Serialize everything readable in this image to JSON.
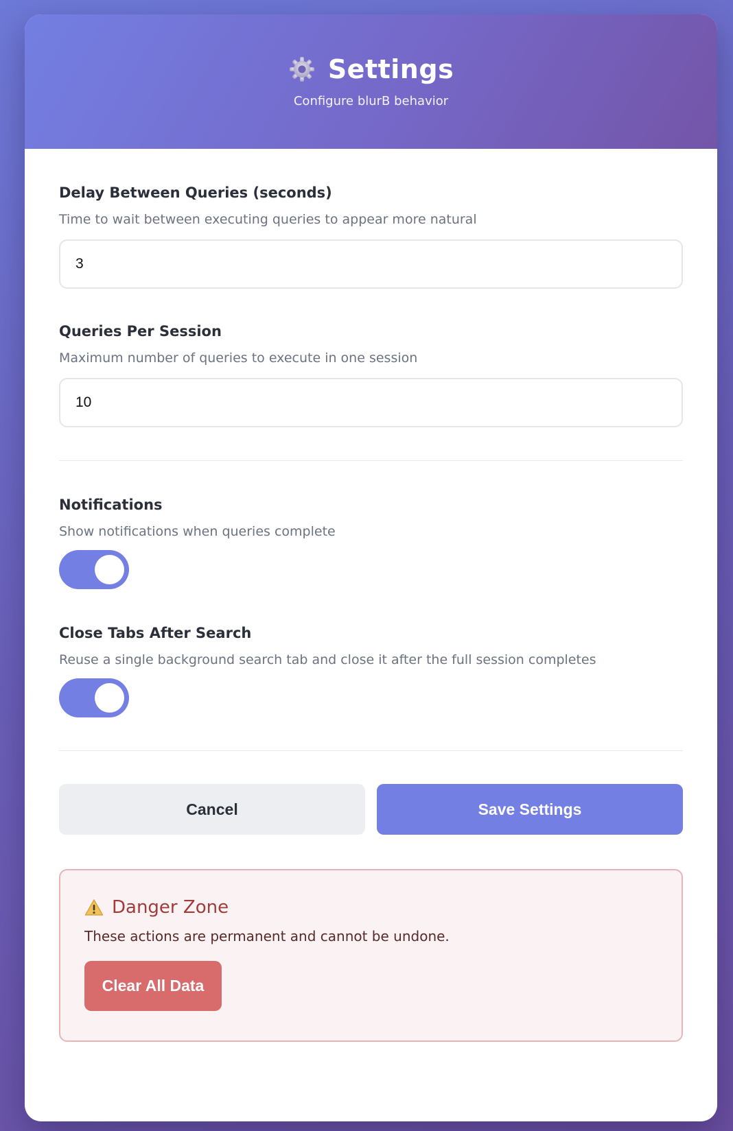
{
  "header": {
    "icon": "gear-icon",
    "title": "Settings",
    "subtitle": "Configure blurB behavior"
  },
  "fields": {
    "delay": {
      "label": "Delay Between Queries (seconds)",
      "description": "Time to wait between executing queries to appear more natural",
      "value": "3"
    },
    "queries_per_session": {
      "label": "Queries Per Session",
      "description": "Maximum number of queries to execute in one session",
      "value": "10"
    }
  },
  "toggles": {
    "notifications": {
      "label": "Notifications",
      "description": "Show notifications when queries complete",
      "enabled": true
    },
    "close_tabs": {
      "label": "Close Tabs After Search",
      "description": "Reuse a single background search tab and close it after the full session completes",
      "enabled": true
    }
  },
  "actions": {
    "cancel_label": "Cancel",
    "save_label": "Save Settings"
  },
  "danger_zone": {
    "icon": "warning-icon",
    "title": "Danger Zone",
    "text": "These actions are permanent and cannot be undone.",
    "clear_label": "Clear All Data"
  },
  "colors": {
    "accent": "#737fe2",
    "danger": "#d86b6b",
    "danger_title": "#a03c3c"
  }
}
